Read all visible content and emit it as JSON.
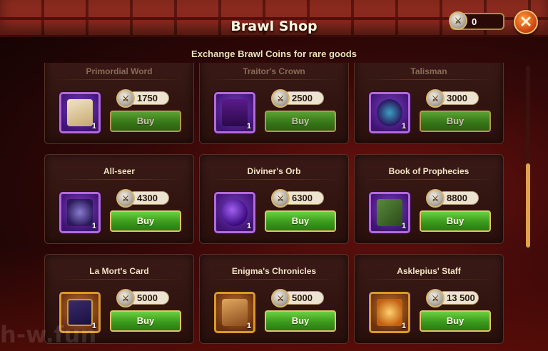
{
  "header": {
    "title": "Brawl Shop",
    "subtitle": "Exchange Brawl Coins for rare goods",
    "coin_balance": "0",
    "close_glyph": "✕"
  },
  "watermark": "h-w.fun",
  "items": [
    {
      "name": "Primordial Word",
      "qty": "1",
      "price": "1750",
      "buy": "Buy",
      "icon": "scroll-icon"
    },
    {
      "name": "Traitor's Crown",
      "qty": "1",
      "price": "2500",
      "buy": "Buy",
      "icon": "crown-icon"
    },
    {
      "name": "Talisman",
      "qty": "1",
      "price": "3000",
      "buy": "Buy",
      "icon": "dreamcatcher-icon"
    },
    {
      "name": "All-seer",
      "qty": "1",
      "price": "4300",
      "buy": "Buy",
      "icon": "eye-orb-icon"
    },
    {
      "name": "Diviner's Orb",
      "qty": "1",
      "price": "6300",
      "buy": "Buy",
      "icon": "orb-icon"
    },
    {
      "name": "Book of Prophecies",
      "qty": "1",
      "price": "8800",
      "buy": "Buy",
      "icon": "book-icon"
    },
    {
      "name": "La Mort's Card",
      "qty": "1",
      "price": "5000",
      "buy": "Buy",
      "icon": "card-icon"
    },
    {
      "name": "Enigma's Chronicles",
      "qty": "1",
      "price": "5000",
      "buy": "Buy",
      "icon": "chronicles-icon"
    },
    {
      "name": "Asklepius' Staff",
      "qty": "1",
      "price": "13 500",
      "buy": "Buy",
      "icon": "staff-icon"
    }
  ],
  "colors": {
    "epic_border": "#b46ad8",
    "legendary_border": "#d99a2a",
    "buy_green": "#3b9a1c",
    "accent_gold": "#e7c16a"
  }
}
